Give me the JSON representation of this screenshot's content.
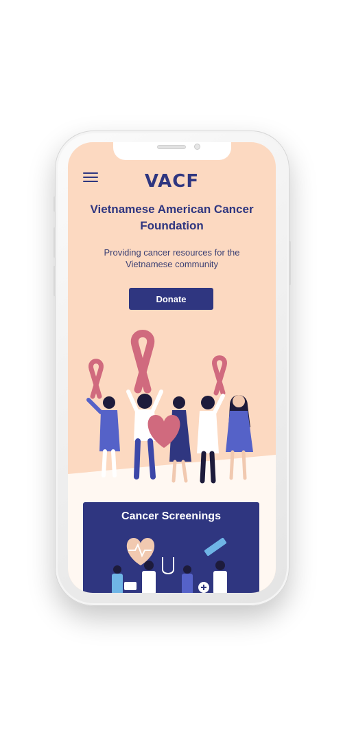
{
  "header": {
    "logo": "VACF",
    "menu_icon": "hamburger-menu-icon"
  },
  "hero": {
    "title": "Vietnamese American Cancer Foundation",
    "subtitle": "Providing cancer resources for the Vietnamese community",
    "donate_label": "Donate",
    "illustration": "women-holding-awareness-ribbons-and-heart"
  },
  "sections": [
    {
      "title": "Cancer Screenings",
      "illustration": "medical-team-screening"
    }
  ],
  "colors": {
    "brand": "#2f3680",
    "background": "#fcd9c1",
    "ribbon": "#d06a7e",
    "white": "#ffffff"
  }
}
